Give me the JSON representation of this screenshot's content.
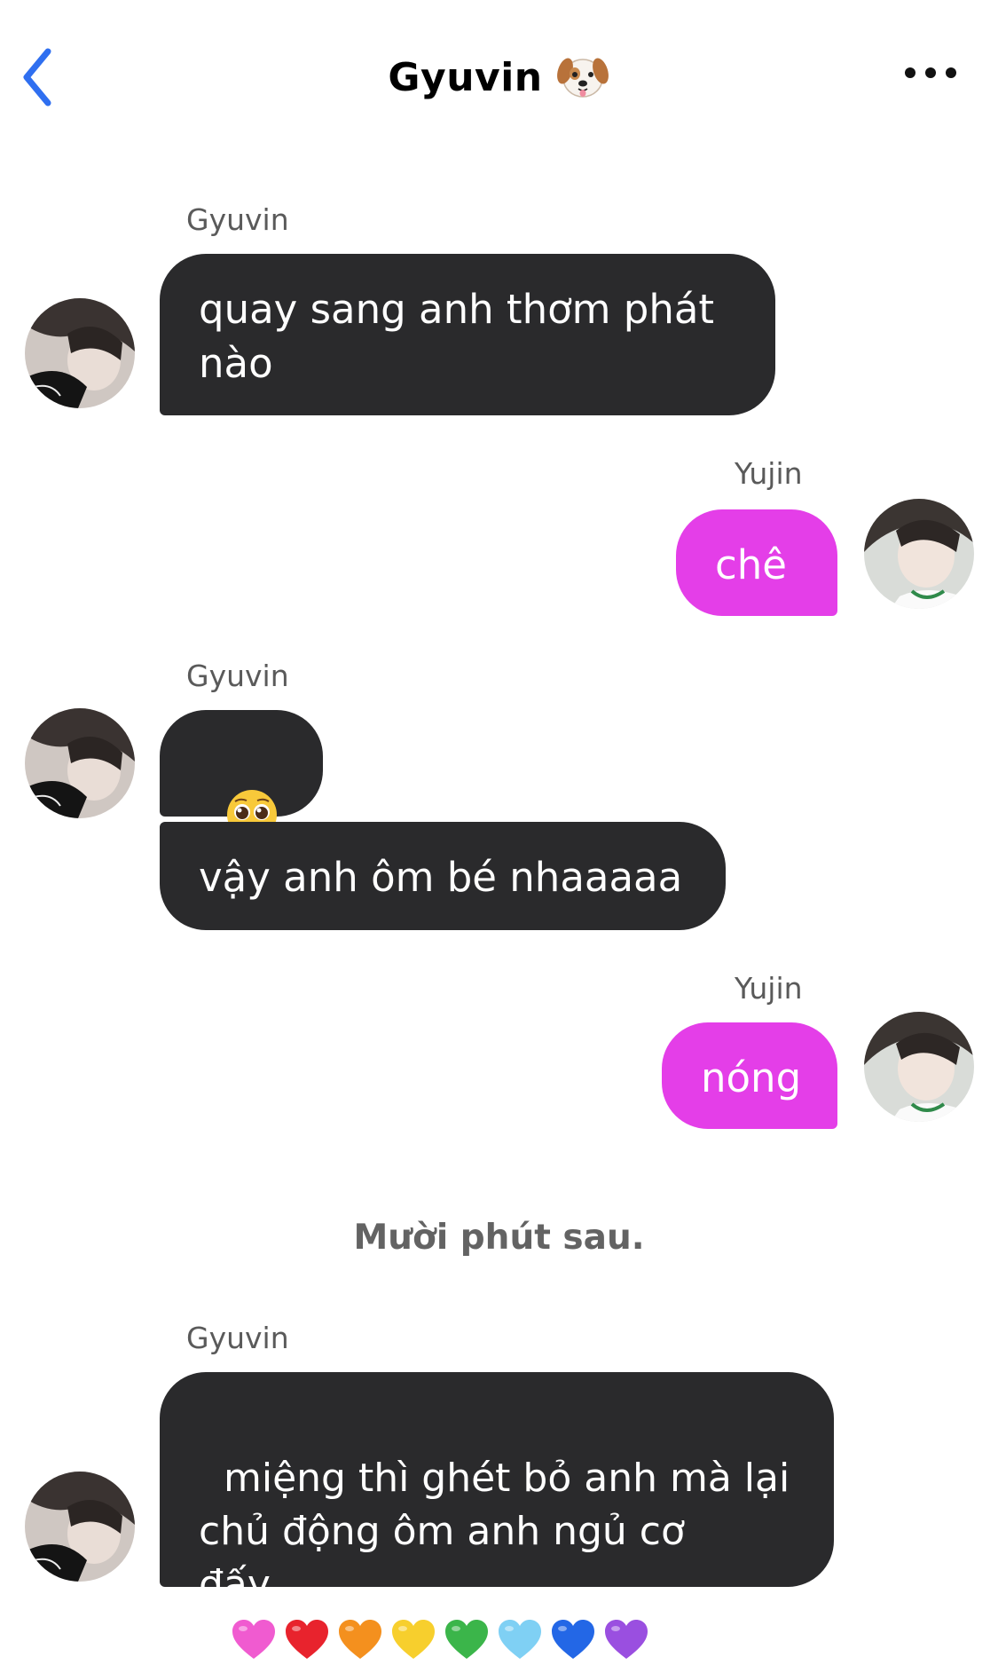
{
  "header": {
    "title": "Gyuvin",
    "title_icon": "dog-face-emoji",
    "back_icon": "chevron-left-icon",
    "more_icon": "ellipsis-icon",
    "accent_color": "#2f6ff0"
  },
  "messages": [
    {
      "sender": "Gyuvin",
      "side": "left",
      "text": "quay sang anh thơm phát\nnào"
    },
    {
      "sender": "Yujin",
      "side": "right",
      "text": "chê"
    },
    {
      "sender": "Gyuvin",
      "side": "left",
      "text": "🥺",
      "emoji_name": "pleading-face-emoji"
    },
    {
      "sender": "",
      "side": "left",
      "text": "vậy anh ôm bé nhaaaaa"
    },
    {
      "sender": "Yujin",
      "side": "right",
      "text": "nóng"
    },
    {
      "sender": "Gyuvin",
      "side": "left",
      "text": "miệng thì ghét bỏ anh mà lại\nchủ động ôm anh ngủ cơ\nđấy",
      "trailing_icons": [
        "pink-heart",
        "red-heart",
        "orange-heart",
        "yellow-heart",
        "green-heart",
        "light-blue-heart",
        "blue-heart",
        "purple-heart"
      ]
    }
  ],
  "divider": "Mười phút sau.",
  "colors": {
    "incoming_bubble": "#2a2a2c",
    "outgoing_bubble": "#e43ee8",
    "sender_label": "#5a5a5a"
  },
  "hearts": [
    "#f05bd0",
    "#e8232d",
    "#f4901e",
    "#f7cf2d",
    "#3bb54a",
    "#7fd0f4",
    "#2367e6",
    "#9a4fe0"
  ]
}
